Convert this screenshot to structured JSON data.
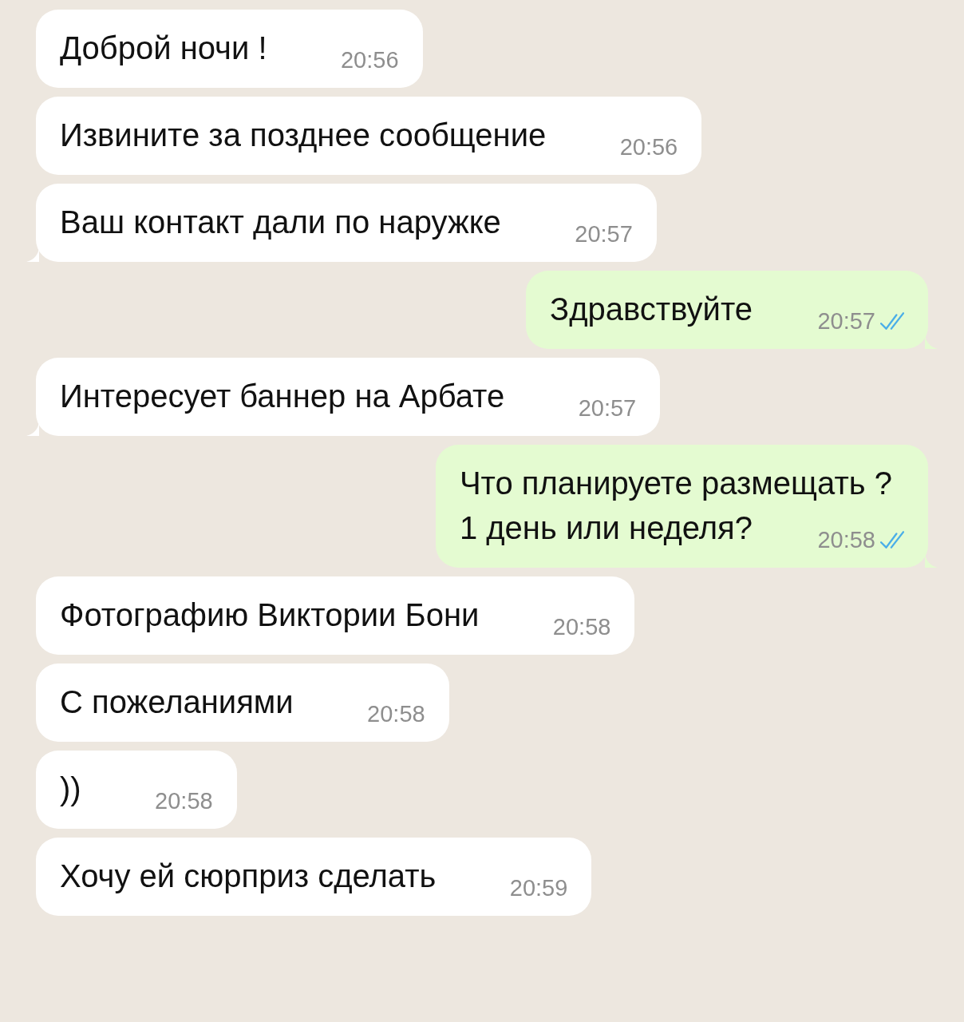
{
  "messages": [
    {
      "kind": "incoming",
      "text": "Доброй ночи !",
      "time": "20:56",
      "tail": false
    },
    {
      "kind": "incoming",
      "text": "Извините за позднее сообщение",
      "time": "20:56",
      "tail": false
    },
    {
      "kind": "incoming",
      "text": "Ваш контакт дали по наружке",
      "time": "20:57",
      "tail": true
    },
    {
      "kind": "outgoing",
      "text": "Здравствуйте",
      "time": "20:57",
      "tail": true,
      "read": true
    },
    {
      "kind": "incoming",
      "text": "Интересует баннер на Арбате",
      "time": "20:57",
      "tail": true
    },
    {
      "kind": "outgoing",
      "text": "Что планируете размещать ?\n1 день или неделя?",
      "time": "20:58",
      "tail": true,
      "read": true
    },
    {
      "kind": "incoming",
      "text": "Фотографию Виктории Бони",
      "time": "20:58",
      "tail": false
    },
    {
      "kind": "incoming",
      "text": "С пожеланиями",
      "time": "20:58",
      "tail": false
    },
    {
      "kind": "incoming",
      "text": "))",
      "time": "20:58",
      "tail": false
    },
    {
      "kind": "incoming",
      "text": "Хочу ей сюрприз сделать",
      "time": "20:59",
      "tail": false
    }
  ]
}
